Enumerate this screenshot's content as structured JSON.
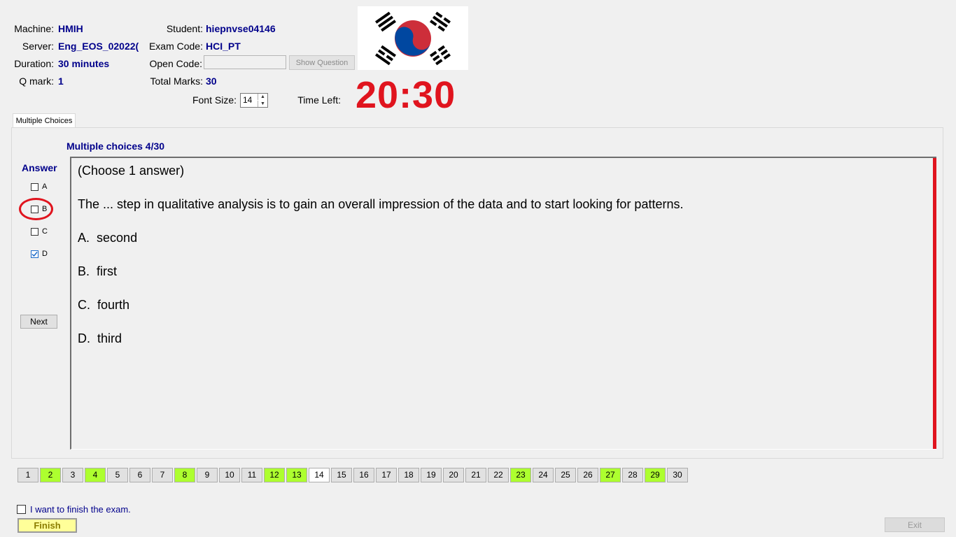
{
  "header": {
    "machine_label": "Machine:",
    "machine_value": "HMIH",
    "server_label": "Server:",
    "server_value": "Eng_EOS_02022(",
    "duration_label": "Duration:",
    "duration_value": "30 minutes",
    "qmark_label": "Q mark:",
    "qmark_value": "1",
    "student_label": "Student:",
    "student_value": "hiepnvse04146",
    "exam_code_label": "Exam Code:",
    "exam_code_value": "HCI_PT",
    "open_code_label": "Open Code:",
    "open_code_value": "",
    "show_question_label": "Show Question",
    "total_marks_label": "Total Marks:",
    "total_marks_value": "30",
    "font_size_label": "Font Size:",
    "font_size_value": "14",
    "time_left_label": "Time Left:",
    "time_left_value": "20:30"
  },
  "flag": {
    "icon": "south-korea-flag",
    "colors": {
      "red": "#cd2e3a",
      "blue": "#0047a0",
      "black": "#000000"
    }
  },
  "tabs": [
    {
      "label": "Multiple Choices",
      "active": true
    }
  ],
  "question": {
    "heading": "Multiple choices 4/30",
    "instruction": "(Choose 1 answer)",
    "text": "The ... step in qualitative analysis is to gain an overall impression of the data and to start looking for patterns.",
    "options": [
      {
        "letter": "A.",
        "text": "second"
      },
      {
        "letter": "B.",
        "text": "first"
      },
      {
        "letter": "C.",
        "text": "fourth"
      },
      {
        "letter": "D.",
        "text": "third"
      }
    ]
  },
  "answer_panel": {
    "title": "Answer",
    "choices": [
      {
        "label": "A",
        "checked": false
      },
      {
        "label": "B",
        "checked": false,
        "highlighted": true
      },
      {
        "label": "C",
        "checked": false
      },
      {
        "label": "D",
        "checked": true
      }
    ],
    "next_label": "Next"
  },
  "question_nav": {
    "numbers": [
      "1",
      "2",
      "3",
      "4",
      "5",
      "6",
      "7",
      "8",
      "9",
      "10",
      "11",
      "12",
      "13",
      "14",
      "15",
      "16",
      "17",
      "18",
      "19",
      "20",
      "21",
      "22",
      "23",
      "24",
      "25",
      "26",
      "27",
      "28",
      "29",
      "30"
    ],
    "answered": [
      "2",
      "4",
      "8",
      "12",
      "13",
      "23",
      "27",
      "29"
    ],
    "current": "14",
    "colors": {
      "answered": "#adff2f"
    }
  },
  "footer": {
    "finish_check_label": "I want to finish the exam.",
    "finish_label": "Finish",
    "exit_label": "Exit"
  },
  "colors": {
    "accent_blue": "#00008b",
    "timer_red": "#e0141e"
  }
}
